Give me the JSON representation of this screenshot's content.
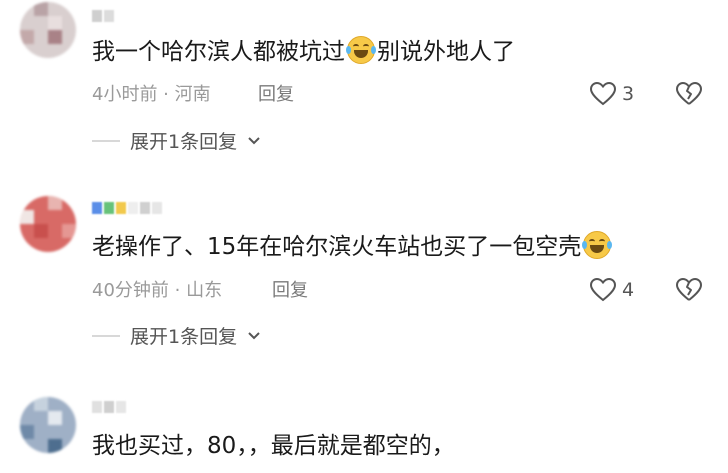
{
  "comments": [
    {
      "text_before": "我一个哈尔滨人都被坑过",
      "text_after": "别说外地人了",
      "time": "4小时前",
      "location": "河南",
      "reply_label": "回复",
      "like_count": "3",
      "expand_label": "展开1条回复"
    },
    {
      "text_before": "老操作了、15年在哈尔滨火车站也买了一包空壳",
      "text_after": "",
      "time": "40分钟前",
      "location": "山东",
      "reply_label": "回复",
      "like_count": "4",
      "expand_label": "展开1条回复"
    },
    {
      "text_before": "我也买过，80，，最后就是都空的，",
      "text_after": "",
      "time": "",
      "location": "",
      "reply_label": "",
      "like_count": ""
    }
  ],
  "meta_separator": " · ",
  "icons": [
    "heart-outline-icon",
    "broken-heart-icon",
    "chevron-down-icon",
    "laugh-cry-emoji"
  ],
  "colors": {
    "meta": "#9a9a9a",
    "text": "#1a1a1a",
    "icon": "#555555"
  }
}
